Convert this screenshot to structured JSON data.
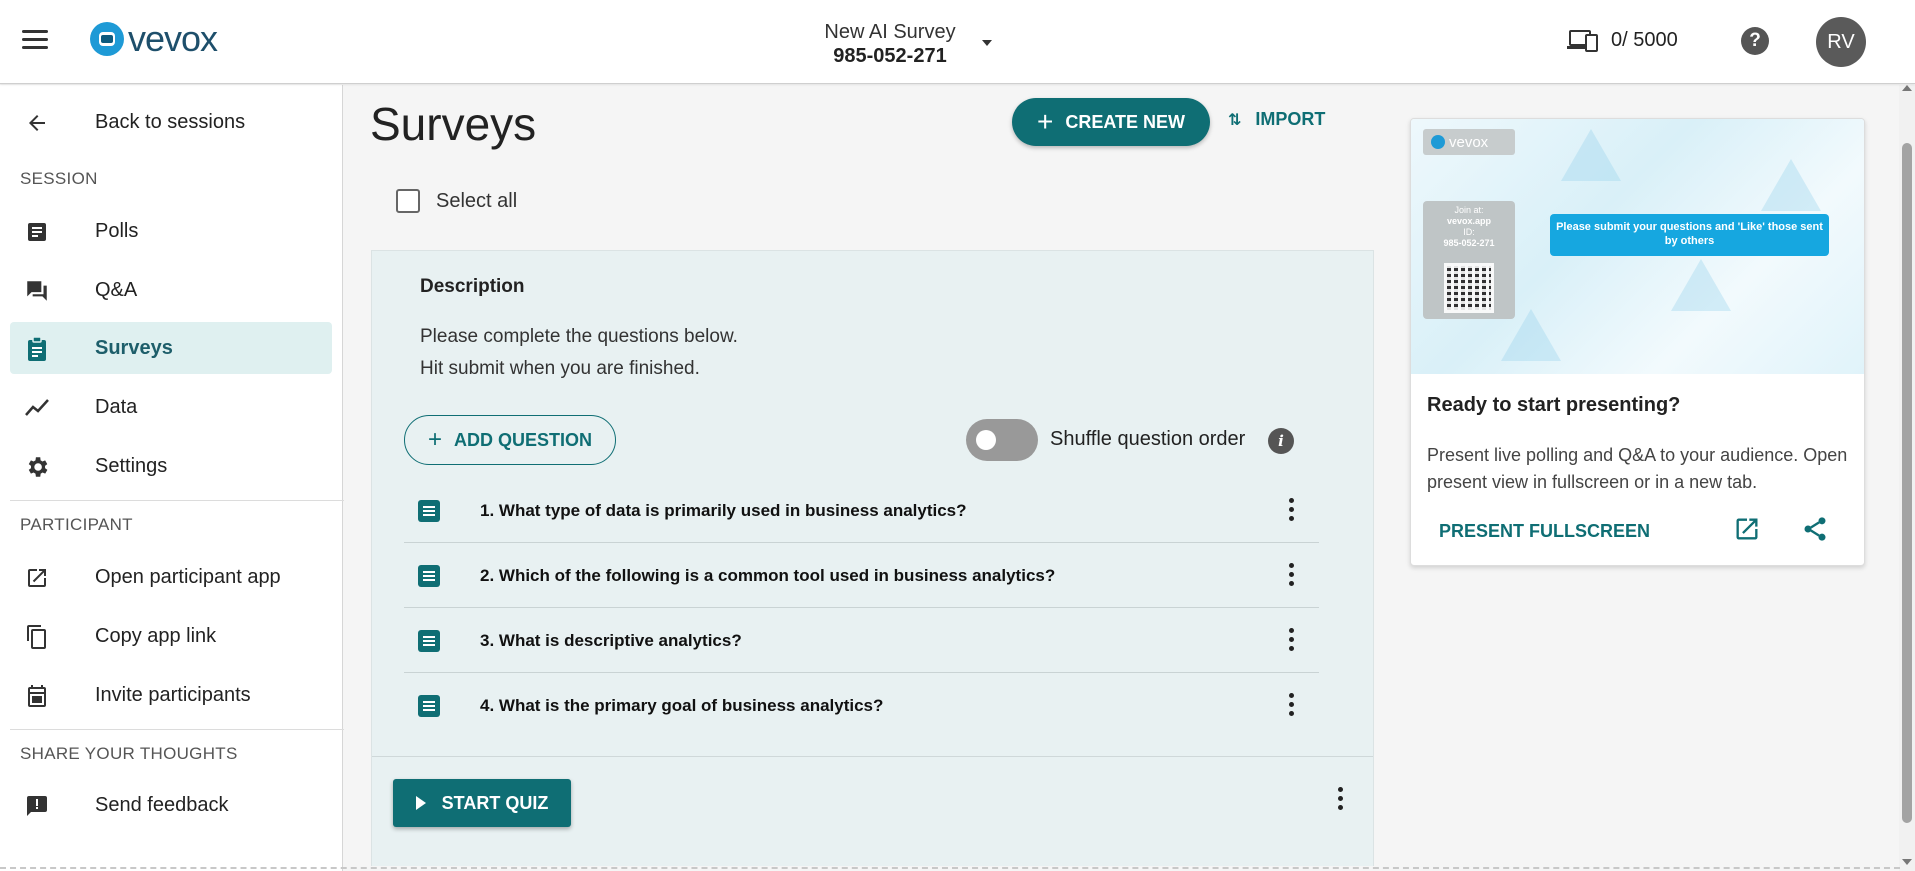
{
  "header": {
    "logo_text": "vevox",
    "session_name": "New AI Survey",
    "session_id": "985-052-271",
    "participants": "0/ 5000",
    "help": "?",
    "avatar_initials": "RV"
  },
  "sidebar": {
    "back_label": "Back to sessions",
    "session_section": "SESSION",
    "session_items": [
      {
        "label": "Polls",
        "icon": "polls-icon"
      },
      {
        "label": "Q&A",
        "icon": "qa-icon"
      },
      {
        "label": "Surveys",
        "icon": "surveys-icon",
        "active": true
      },
      {
        "label": "Data",
        "icon": "data-icon"
      },
      {
        "label": "Settings",
        "icon": "gear-icon"
      }
    ],
    "participant_section": "PARTICIPANT",
    "participant_items": [
      {
        "label": "Open participant app",
        "icon": "open-external-icon"
      },
      {
        "label": "Copy app link",
        "icon": "copy-icon"
      },
      {
        "label": "Invite participants",
        "icon": "calendar-icon"
      }
    ],
    "feedback_section": "SHARE YOUR THOUGHTS",
    "feedback_items": [
      {
        "label": "Send feedback",
        "icon": "feedback-icon"
      }
    ]
  },
  "main": {
    "title": "Surveys",
    "create_label": "CREATE NEW",
    "import_label": "IMPORT",
    "select_all_label": "Select all",
    "survey": {
      "description_title": "Description",
      "description_lines": [
        "Please complete the questions below.",
        "Hit submit when you are finished."
      ],
      "add_question_label": "ADD QUESTION",
      "shuffle_label": "Shuffle question order",
      "shuffle_on": false,
      "questions": [
        "1. What type of data is primarily used in business analytics?",
        "2. Which of the following is a common tool used in business analytics?",
        "3. What is descriptive analytics?",
        "4. What is the primary goal of business analytics?"
      ],
      "start_label": "START QUIZ"
    }
  },
  "present": {
    "preview": {
      "logo": "vevox",
      "join_at": "Join at:",
      "join_url": "vevox.app",
      "id_label": "ID:",
      "id_value": "985-052-271",
      "message": "Please submit your questions and 'Like' those sent by others"
    },
    "title": "Ready to start presenting?",
    "text": "Present live polling and Q&A to your audience. Open present view in fullscreen or in a new tab.",
    "fullscreen_label": "PRESENT FULLSCREEN"
  },
  "colors": {
    "accent": "#0f6e74",
    "active_bg": "#dff0f0",
    "card_bg": "#e8f1f2",
    "preview_message": "#16a7e0"
  }
}
